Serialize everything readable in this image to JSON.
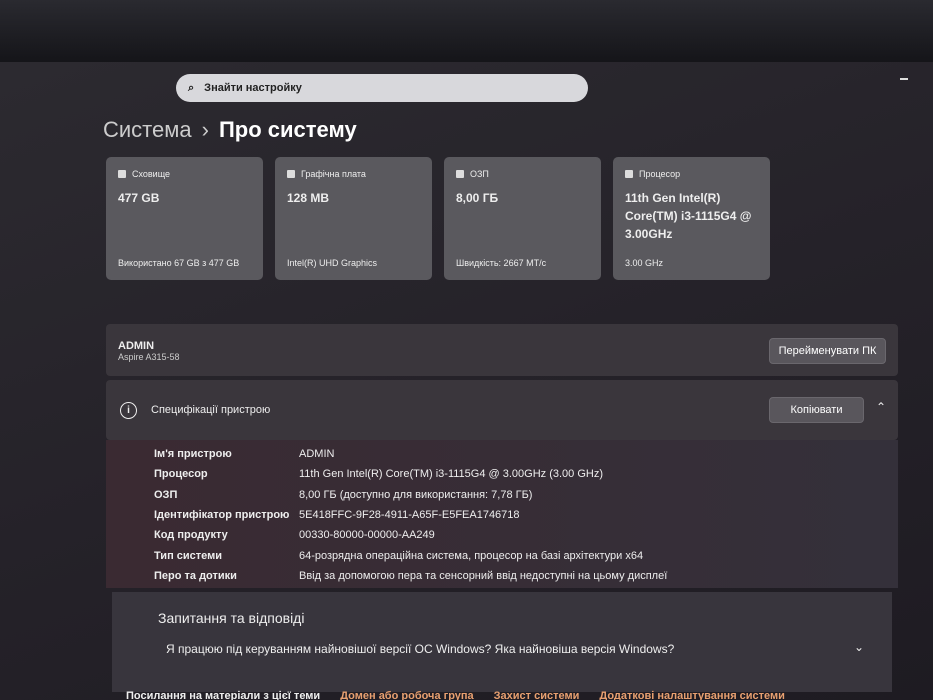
{
  "search": {
    "placeholder": "Знайти настройку"
  },
  "breadcrumb": {
    "parent": "Система",
    "separator": "›",
    "current": "Про систему"
  },
  "cards": [
    {
      "icon": "storage-icon",
      "label": "Сховище",
      "value": "477 GB",
      "sub": "Використано 67 GB з 477 GB"
    },
    {
      "icon": "gpu-icon",
      "label": "Графічна плата",
      "value": "128 MB",
      "sub": "Intel(R) UHD Graphics"
    },
    {
      "icon": "ram-icon",
      "label": "ОЗП",
      "value": "8,00 ГБ",
      "sub": "Швидкість: 2667 MT/c"
    },
    {
      "icon": "cpu-icon",
      "label": "Процесор",
      "value": "11th Gen Intel(R) Core(TM) i3-1115G4 @ 3.00GHz",
      "sub": "3.00 GHz"
    }
  ],
  "device": {
    "name": "ADMIN",
    "model": "Aspire A315-58",
    "rename_label": "Перейменувати ПК"
  },
  "specs": {
    "title": "Специфікації пристрою",
    "copy_label": "Копіювати",
    "rows": [
      {
        "k": "Ім'я пристрою",
        "v": "ADMIN"
      },
      {
        "k": "Процесор",
        "v": "11th Gen Intel(R) Core(TM) i3-1115G4 @ 3.00GHz (3.00 GHz)"
      },
      {
        "k": "ОЗП",
        "v": "8,00 ГБ (доступно для використання: 7,78 ГБ)"
      },
      {
        "k": "Ідентифікатор пристрою",
        "v": "5E418FFC-9F28-4911-A65F-E5FEA1746718"
      },
      {
        "k": "Код продукту",
        "v": "00330-80000-00000-AA249"
      },
      {
        "k": "Тип системи",
        "v": "64-розрядна операційна система, процесор на базі архітектури x64"
      },
      {
        "k": "Перо та дотики",
        "v": "Ввід за допомогою пера та сенсорний ввід недоступні на цьому дисплеї"
      }
    ]
  },
  "qa": {
    "title": "Запитання та відповіді",
    "question": "Я працюю під керуванням найновішої версії ОС Windows? Яка найновіша версія Windows?"
  },
  "links": {
    "label": "Посилання на матеріали з цієї теми",
    "items": [
      "Домен або робоча група",
      "Захист системи",
      "Додаткові налаштування системи"
    ]
  }
}
